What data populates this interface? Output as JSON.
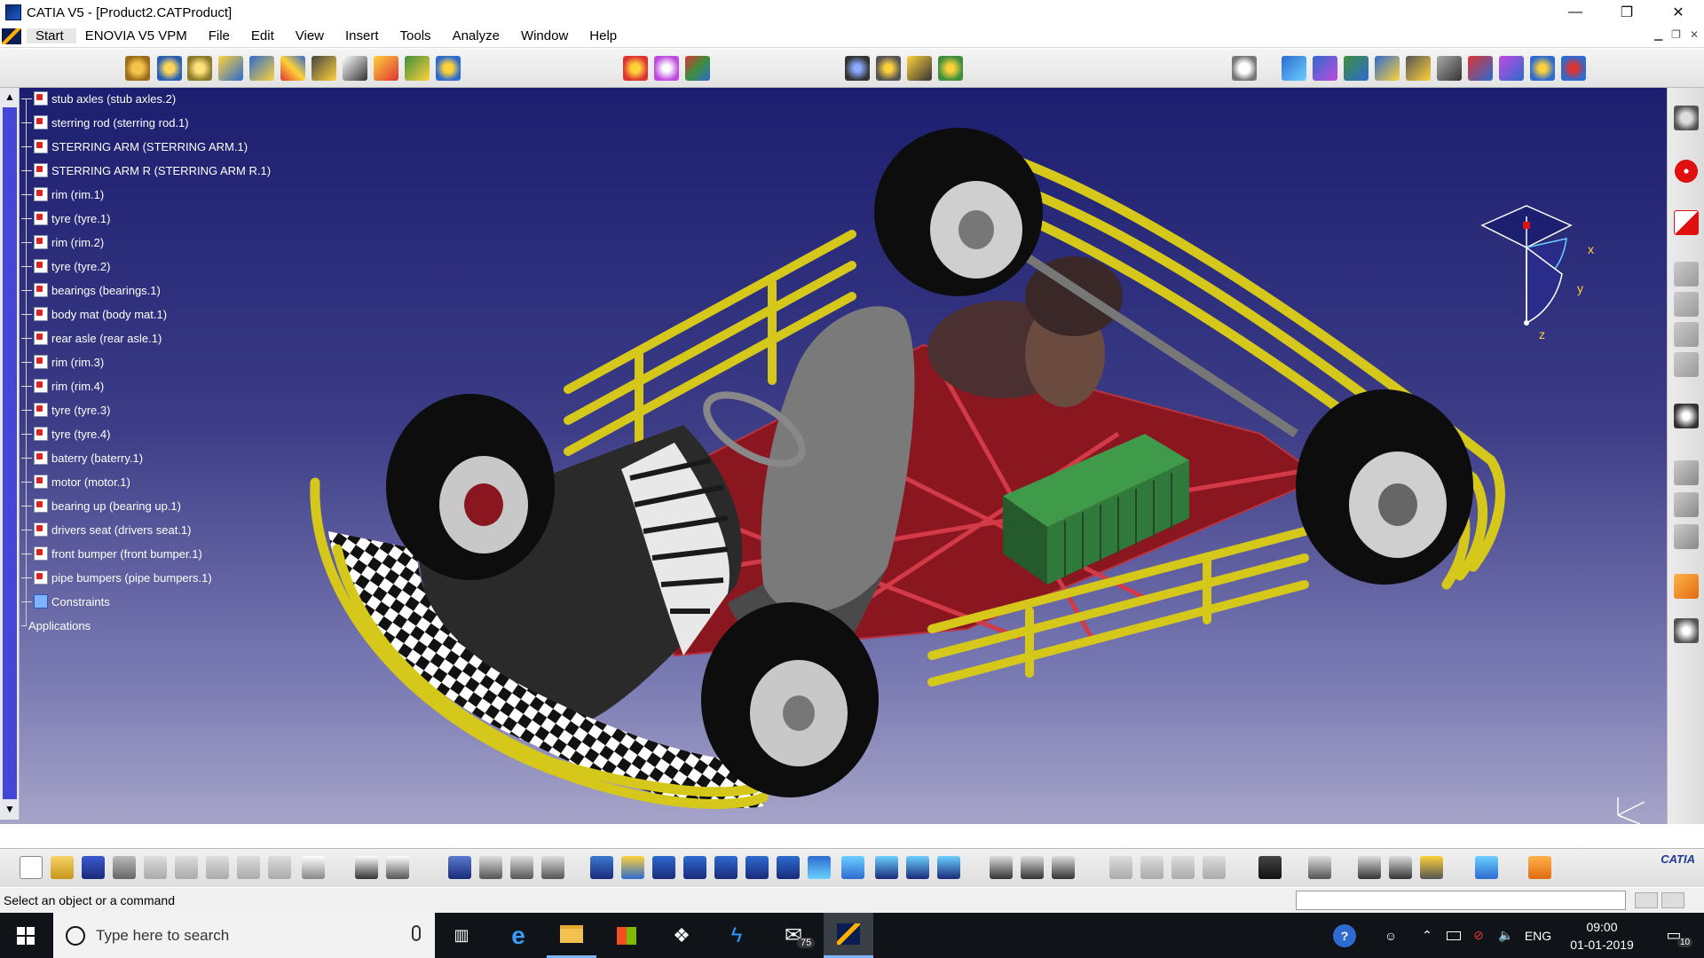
{
  "window": {
    "title": "CATIA V5 - [Product2.CATProduct]",
    "minimize": "—",
    "maximize": "❐",
    "close": "✕"
  },
  "menu": {
    "items": [
      "Start",
      "ENOVIA V5 VPM",
      "File",
      "Edit",
      "View",
      "Insert",
      "Tools",
      "Analyze",
      "Window",
      "Help"
    ]
  },
  "tree": {
    "items": [
      "stub axles (stub axles.2)",
      "sterring rod (sterring rod.1)",
      "STERRING ARM (STERRING ARM.1)",
      "STERRING ARM R (STERRING ARM R.1)",
      "rim (rim.1)",
      "tyre (tyre.1)",
      "rim (rim.2)",
      "tyre (tyre.2)",
      "bearings (bearings.1)",
      "body mat (body mat.1)",
      "rear asle (rear asle.1)",
      "rim (rim.3)",
      "rim (rim.4)",
      "tyre (tyre.3)",
      "tyre (tyre.4)",
      "baterry (baterry.1)",
      "motor (motor.1)",
      "bearing up (bearing up.1)",
      "drivers seat (drivers seat.1)",
      "front bumper (front bumper.1)",
      "pipe bumpers (pipe bumpers.1)"
    ],
    "constraints": "Constraints",
    "applications": "Applications"
  },
  "compass": {
    "x": "x",
    "y": "y",
    "z": "z"
  },
  "status": {
    "text": "Select an object or a command"
  },
  "taskbar": {
    "search_placeholder": "Type here to search",
    "mail_badge": "75",
    "language": "ENG",
    "time": "09:00",
    "date": "01-01-2019",
    "notification_count": "10"
  },
  "branding": {
    "catia_logo": "CATIA"
  },
  "colors": {
    "viewport_top": "#1c1e6f",
    "viewport_bottom": "#a6a4c8",
    "bumper_yellow": "#d6c81a",
    "chassis_red": "#8a1620",
    "battery_green": "#2f7a3a",
    "scrollbar_blue": "#4545d8"
  }
}
